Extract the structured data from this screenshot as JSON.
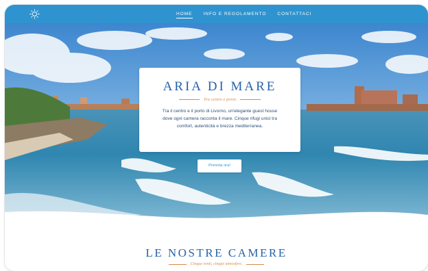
{
  "nav": {
    "items": [
      {
        "label": "HOME",
        "active": true
      },
      {
        "label": "INFO E REGOLAMENTO",
        "active": false
      },
      {
        "label": "CONTATTACI",
        "active": false
      }
    ],
    "logo_icon": "sun-icon"
  },
  "hero": {
    "title": "ARIA DI MARE",
    "subtitle": "Tra centro e porto",
    "description": "Tra il centro e il porto di Livorno, un'elegante guest house dove ogni camera racconta il mare. Cinque rifugi unici tra comfort, autenticità e brezza mediterranea.",
    "cta_label": "Prenota ora!"
  },
  "rooms": {
    "title": "LE NOSTRE CAMERE",
    "subtitle": "Cinque venti, cinque atmosfere."
  },
  "colors": {
    "nav_bg": "#2f93cf",
    "title": "#2563a8",
    "accent": "#d98a45"
  }
}
